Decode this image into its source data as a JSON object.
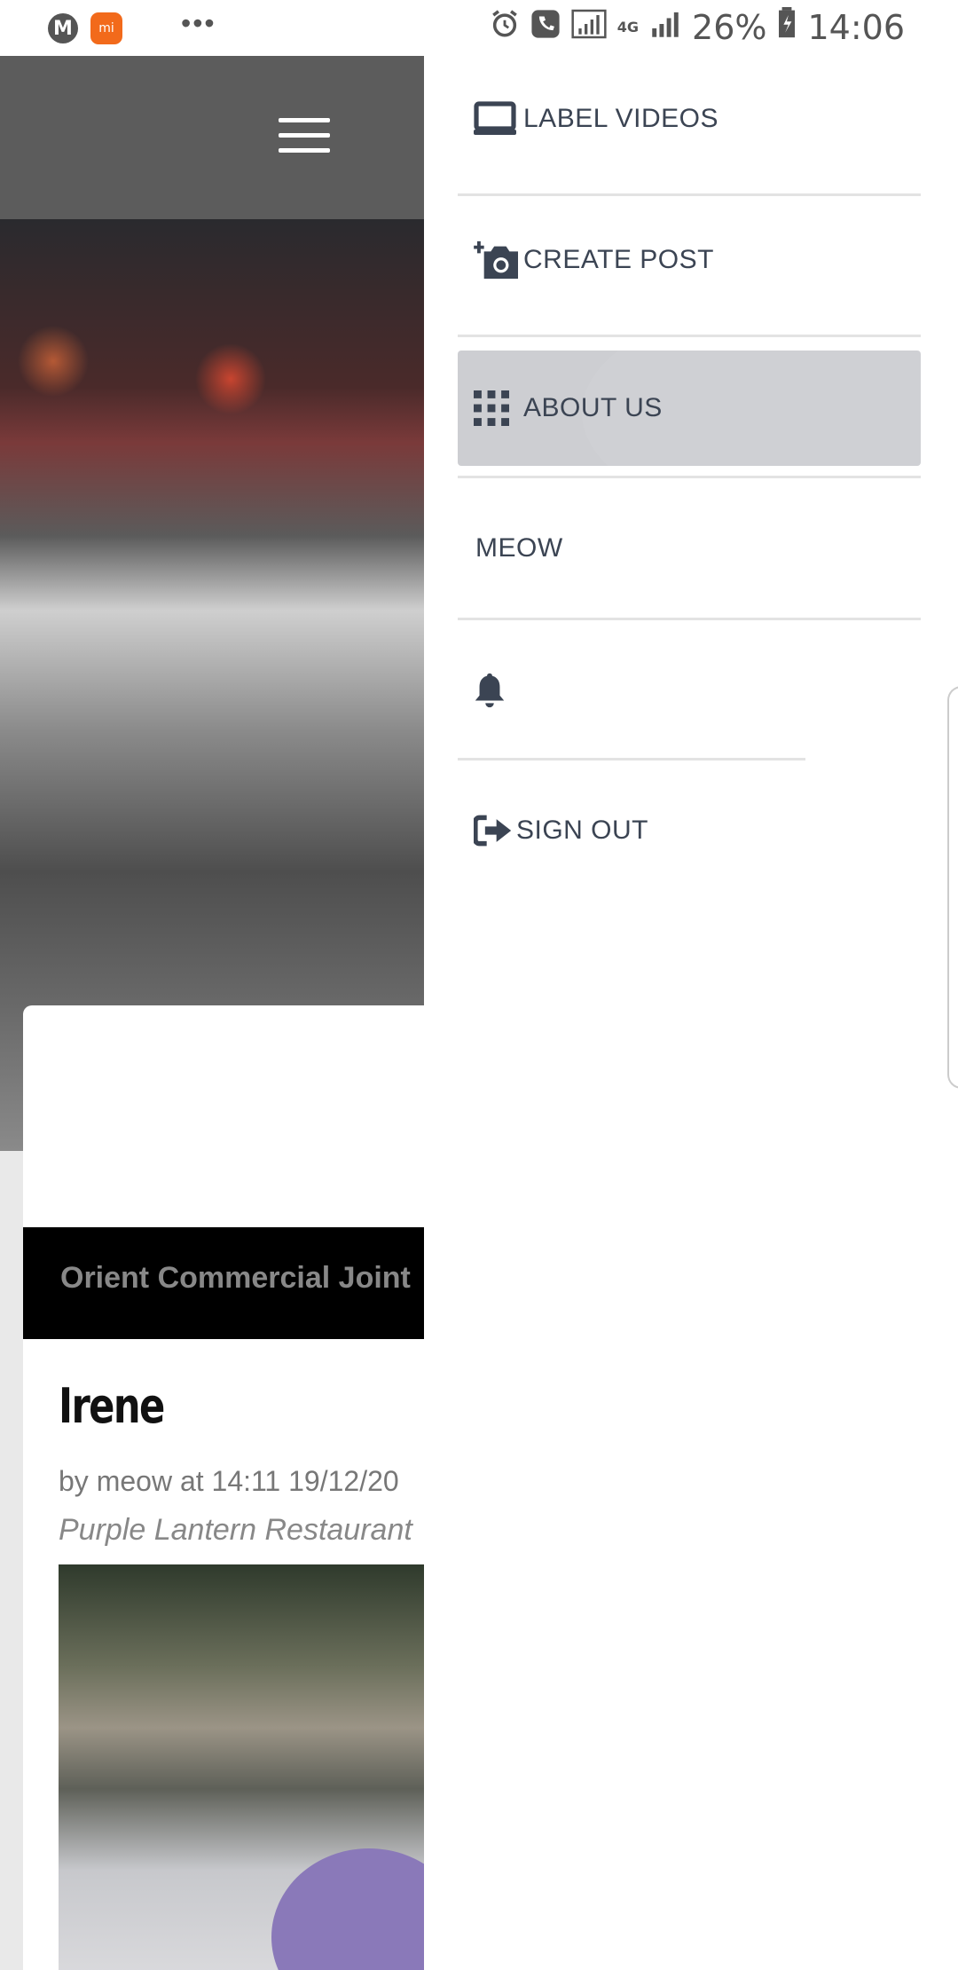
{
  "status_bar": {
    "app_icon_1": "M",
    "app_icon_2": "mi",
    "more": "•••",
    "battery": "26%",
    "time": "14:06",
    "network": "4G"
  },
  "page": {
    "org_name": "Orient Commercial Joint",
    "post_title": "Irene",
    "post_meta": "by meow at 14:11 19/12/20",
    "post_location": "Purple Lantern Restaurant"
  },
  "drawer": {
    "items": [
      {
        "label": "LABEL VIDEOS",
        "icon": "monitor-icon"
      },
      {
        "label": "CREATE POST",
        "icon": "add-camera-icon"
      },
      {
        "label": "ABOUT US",
        "icon": "grid-icon"
      },
      {
        "label": "MEOW",
        "icon": ""
      },
      {
        "label": "",
        "icon": "bell-icon"
      },
      {
        "label": "SIGN OUT",
        "icon": "sign-out-icon"
      }
    ]
  },
  "colors": {
    "menu_text": "#3b4453",
    "active_bg": "#cdced2",
    "header_bg": "#5c5c5c"
  }
}
